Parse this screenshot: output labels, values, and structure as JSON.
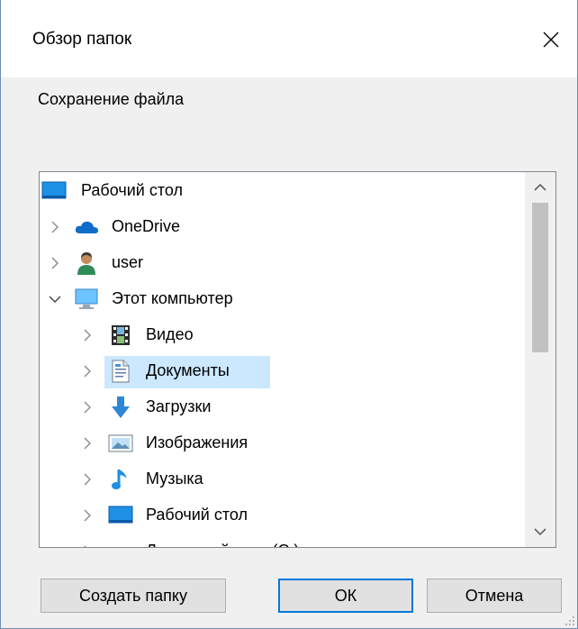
{
  "window": {
    "title": "Обзор папок",
    "prompt": "Сохранение файла"
  },
  "tree": {
    "items": [
      {
        "label": "Рабочий стол",
        "icon": "desktop-icon",
        "level": 0,
        "expander": "none"
      },
      {
        "label": "OneDrive",
        "icon": "onedrive-cloud-icon",
        "level": 1,
        "expander": "collapsed"
      },
      {
        "label": "user",
        "icon": "user-icon",
        "level": 1,
        "expander": "collapsed"
      },
      {
        "label": "Этот компьютер",
        "icon": "computer-icon",
        "level": 1,
        "expander": "expanded"
      },
      {
        "label": "Видео",
        "icon": "video-icon",
        "level": 2,
        "expander": "collapsed"
      },
      {
        "label": "Документы",
        "icon": "documents-icon",
        "level": 2,
        "expander": "collapsed",
        "selected": true
      },
      {
        "label": "Загрузки",
        "icon": "downloads-icon",
        "level": 2,
        "expander": "collapsed"
      },
      {
        "label": "Изображения",
        "icon": "pictures-icon",
        "level": 2,
        "expander": "collapsed"
      },
      {
        "label": "Музыка",
        "icon": "music-icon",
        "level": 2,
        "expander": "collapsed"
      },
      {
        "label": "Рабочий стол",
        "icon": "desktop-icon",
        "level": 2,
        "expander": "collapsed"
      },
      {
        "label": "Локальный диск (C:)",
        "icon": "local-disk-icon",
        "level": 2,
        "expander": "collapsed"
      }
    ]
  },
  "buttons": {
    "new_folder": "Создать папку",
    "ok": "ОК",
    "cancel": "Отмена"
  },
  "colors": {
    "selection": "#cce8ff",
    "accent": "#0078d7",
    "dialog_bg": "#f0f0f0"
  }
}
